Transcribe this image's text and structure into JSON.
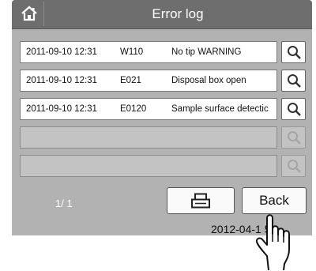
{
  "header": {
    "title": "Error log",
    "home_icon": "home-icon"
  },
  "log": {
    "rows": [
      {
        "date": "2011-09-10 12:31",
        "code": "W110",
        "message": "No tip WARNING"
      },
      {
        "date": "2011-09-10 12:31",
        "code": "E021",
        "message": "Disposal box open"
      },
      {
        "date": "2011-09-10 12:31",
        "code": "E0120",
        "message": "Sample surface detectic"
      },
      {
        "date": "",
        "code": "",
        "message": ""
      },
      {
        "date": "",
        "code": "",
        "message": ""
      }
    ]
  },
  "footer": {
    "page_indicator": "1/ 1",
    "print_icon": "printer-icon",
    "back_label": "Back",
    "datetime": "2012-04-1   5"
  },
  "colors": {
    "panel": "#b2b2b2",
    "header": "#6e6e6e",
    "row": "#ffffff",
    "row_empty": "#c3c3c3"
  }
}
